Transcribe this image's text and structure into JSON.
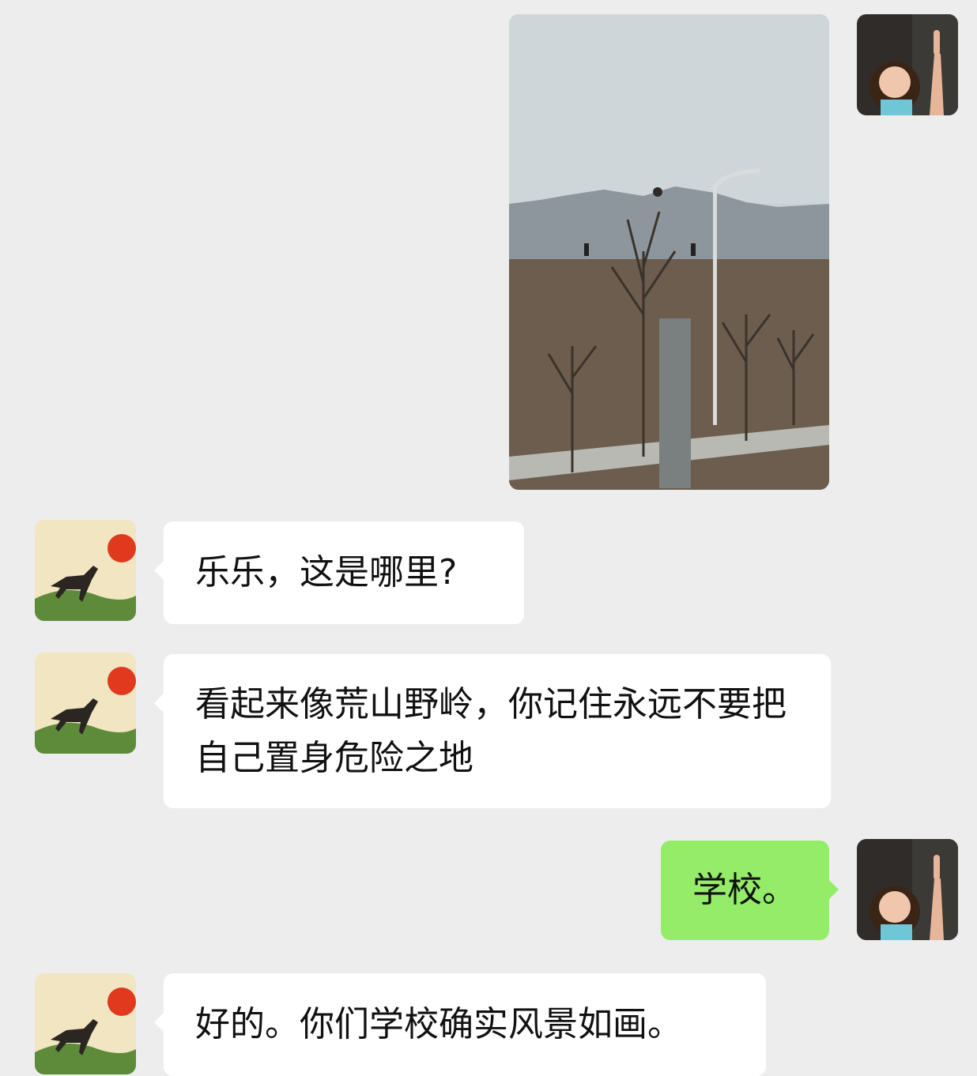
{
  "messages": [
    {
      "sender": "self",
      "type": "image",
      "icon": "photo-landscape"
    },
    {
      "sender": "other",
      "type": "text",
      "text": "乐乐，这是哪里?"
    },
    {
      "sender": "other",
      "type": "text",
      "text": "看起来像荒山野岭，你记住永远不要把自己置身危险之地"
    },
    {
      "sender": "self",
      "type": "text",
      "text": "学校。"
    },
    {
      "sender": "other",
      "type": "text",
      "text": "好的。你们学校确实风景如画。"
    }
  ],
  "colors": {
    "background": "#ededed",
    "bubble_other": "#ffffff",
    "bubble_self": "#95ec69"
  },
  "icons": {
    "other_avatar": "horse-sun-painting-avatar",
    "self_avatar": "girl-selfie-avatar"
  }
}
